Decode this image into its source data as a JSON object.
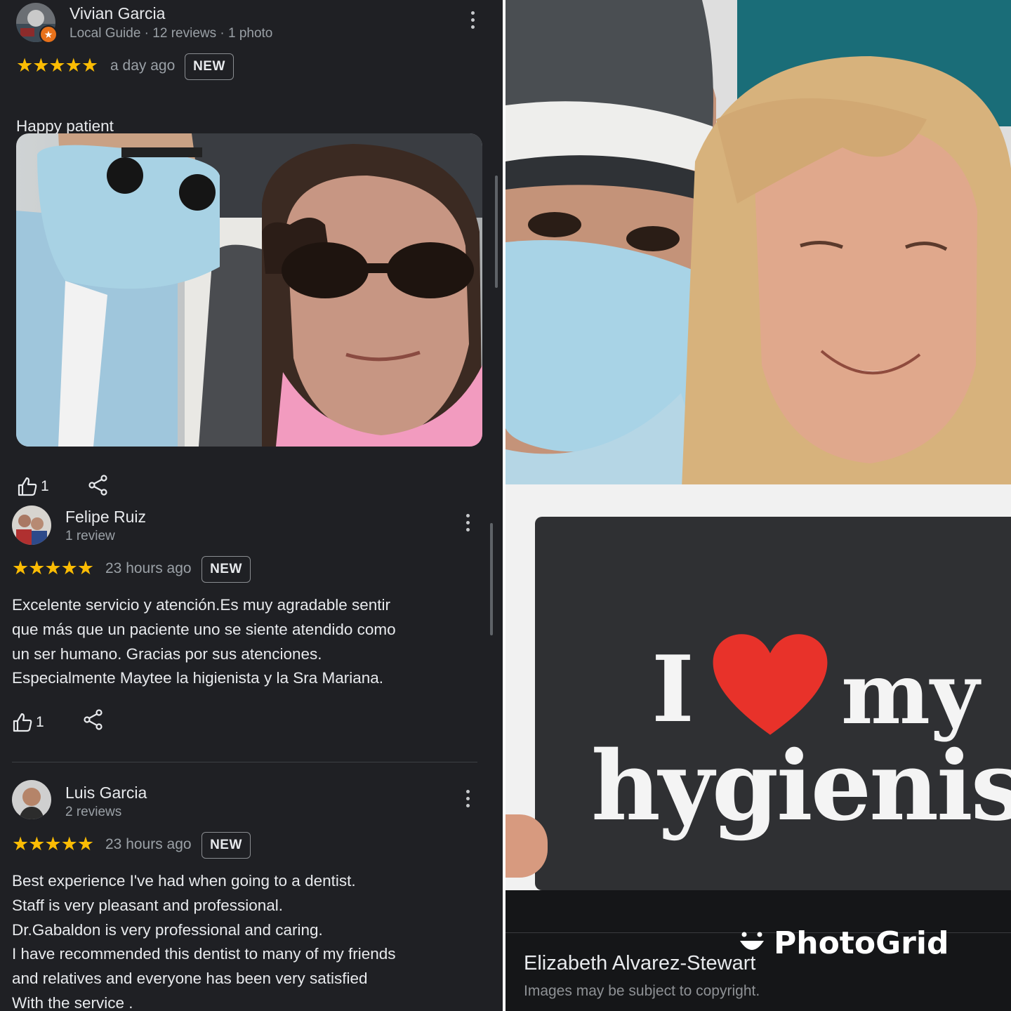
{
  "reviews": [
    {
      "name": "Vivian Garcia",
      "meta": "Local Guide · 12 reviews · 1 photo",
      "stars": "★★★★★",
      "rating": 5,
      "when": "a day ago",
      "badge": "NEW",
      "text": "Happy patient",
      "emoji": "❤️",
      "likes": "1"
    },
    {
      "name": "Felipe Ruiz",
      "meta": "1 review",
      "stars": "★★★★★",
      "rating": 5,
      "when": "23 hours ago",
      "badge": "NEW",
      "text": "Excelente servicio y atención.Es muy agradable sentir\nque más que un paciente uno se siente atendido como\nun ser humano. Gracias por sus atenciones.\nEspecialmente Maytee la higienista y la Sra Mariana.",
      "likes": "1"
    },
    {
      "name": "Luis Garcia",
      "meta": "2 reviews",
      "stars": "★★★★★",
      "rating": 5,
      "when": "23 hours ago",
      "badge": "NEW",
      "text": "Best experience I've had when going to a dentist.\nStaff is very pleasant and professional.\nDr.Gabaldon is very professional and caring.\nI have recommended this dentist to many of my friends\nand relatives and everyone has been very satisfied\nWith the service ."
    }
  ],
  "photo_panel": {
    "sign_line1_left": "I",
    "sign_line1_right": "my",
    "sign_line2": "hygienis",
    "caption_name": "Elizabeth Alvarez-Stewart",
    "caption_note": "Images may be subject to copyright.",
    "watermark": "PhotoGrid"
  },
  "colors": {
    "panel_bg": "#1f2024",
    "star": "#fbbc04",
    "heart": "#e8322a",
    "sign_bg": "#2f3033"
  }
}
